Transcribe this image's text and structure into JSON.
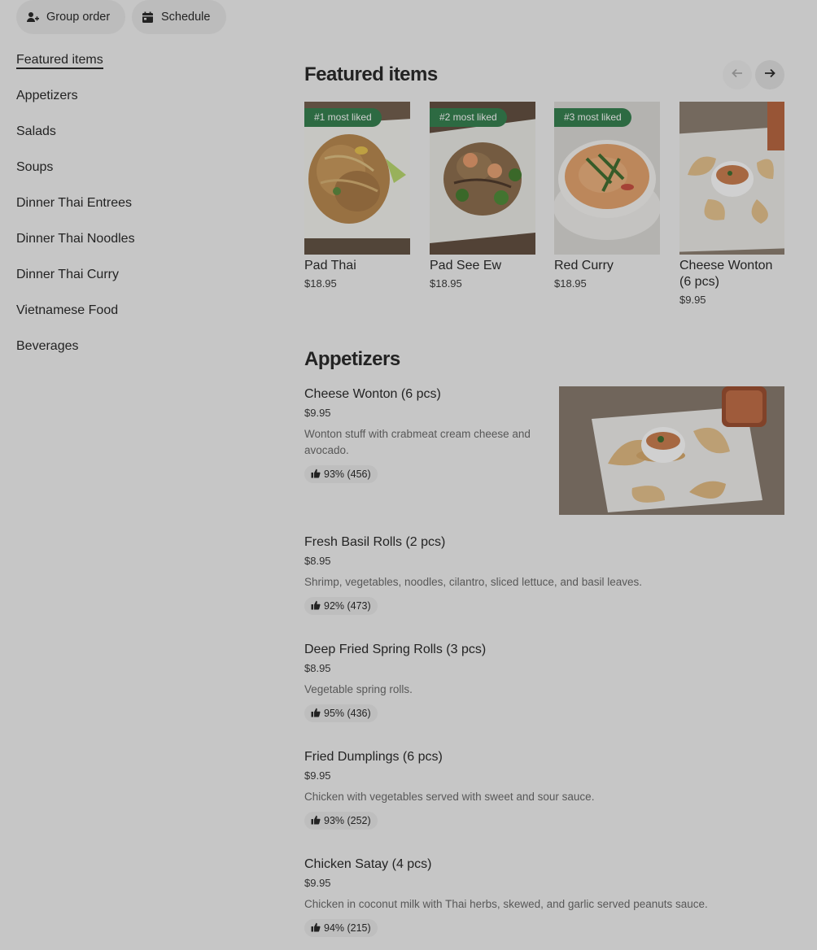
{
  "top": {
    "group_order_label": "Group order",
    "schedule_label": "Schedule"
  },
  "sidebar": {
    "items": [
      {
        "label": "Featured items"
      },
      {
        "label": "Appetizers"
      },
      {
        "label": "Salads"
      },
      {
        "label": "Soups"
      },
      {
        "label": "Dinner Thai Entrees"
      },
      {
        "label": "Dinner Thai Noodles"
      },
      {
        "label": "Dinner Thai Curry"
      },
      {
        "label": "Vietnamese Food"
      },
      {
        "label": "Beverages"
      }
    ]
  },
  "featured": {
    "title": "Featured items",
    "cards": [
      {
        "badge": "#1 most liked",
        "name": "Pad Thai",
        "price": "$18.95"
      },
      {
        "badge": "#2 most liked",
        "name": "Pad See Ew",
        "price": "$18.95"
      },
      {
        "badge": "#3 most liked",
        "name": "Red Curry",
        "price": "$18.95"
      },
      {
        "badge": "",
        "name": "Cheese Wonton (6 pcs)",
        "price": "$9.95"
      }
    ]
  },
  "appetizers": {
    "title": "Appetizers",
    "items": [
      {
        "name": "Cheese Wonton (6 pcs)",
        "price": "$9.95",
        "desc": "Wonton stuff with crabmeat cream cheese and avocado.",
        "rating": "93% (456)"
      },
      {
        "name": "Fresh Basil Rolls (2 pcs)",
        "price": "$8.95",
        "desc": "Shrimp, vegetables, noodles, cilantro, sliced lettuce, and basil leaves.",
        "rating": "92% (473)"
      },
      {
        "name": "Deep Fried Spring Rolls (3 pcs)",
        "price": "$8.95",
        "desc": "Vegetable spring rolls.",
        "rating": "95% (436)"
      },
      {
        "name": "Fried Dumplings (6 pcs)",
        "price": "$9.95",
        "desc": "Chicken with vegetables served with sweet and sour sauce.",
        "rating": "93% (252)"
      },
      {
        "name": "Chicken Satay (4 pcs)",
        "price": "$9.95",
        "desc": "Chicken in coconut milk with Thai herbs, skewed, and garlic served peanuts sauce.",
        "rating": "94% (215)"
      }
    ]
  },
  "colors": {
    "badge_green": "#2f7d4a",
    "page_bg": "#f2f2f2",
    "pill_bg": "#e6e6e6"
  }
}
